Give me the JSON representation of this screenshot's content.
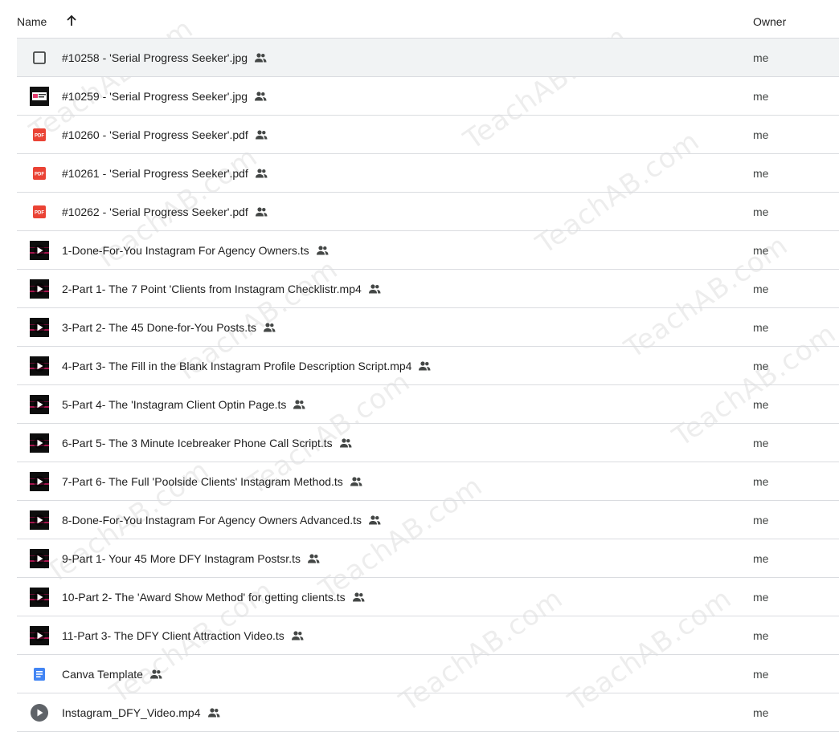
{
  "header": {
    "name_label": "Name",
    "owner_label": "Owner",
    "sort_icon": "arrow-up-icon"
  },
  "files": [
    {
      "name": "#10258 - 'Serial Progress Seeker'.jpg",
      "owner": "me",
      "icon": "image-icon",
      "shared": true
    },
    {
      "name": "#10259 - 'Serial Progress Seeker'.jpg",
      "owner": "me",
      "icon": "image-thumbnail-icon",
      "shared": true
    },
    {
      "name": "#10260 - 'Serial Progress Seeker'.pdf",
      "owner": "me",
      "icon": "pdf-icon",
      "shared": true
    },
    {
      "name": "#10261 - 'Serial Progress Seeker'.pdf",
      "owner": "me",
      "icon": "pdf-icon",
      "shared": true
    },
    {
      "name": "#10262 - 'Serial Progress Seeker'.pdf",
      "owner": "me",
      "icon": "pdf-icon",
      "shared": true
    },
    {
      "name": "1-Done-For-You Instagram For Agency Owners.ts",
      "owner": "me",
      "icon": "video-thumbnail-icon",
      "shared": true
    },
    {
      "name": "2-Part 1- The 7 Point 'Clients from Instagram Checklistr.mp4",
      "owner": "me",
      "icon": "video-thumbnail-icon",
      "shared": true
    },
    {
      "name": "3-Part 2- The 45 Done-for-You Posts.ts",
      "owner": "me",
      "icon": "video-thumbnail-icon",
      "shared": true
    },
    {
      "name": "4-Part 3- The Fill in the Blank Instagram Profile Description Script.mp4",
      "owner": "me",
      "icon": "video-thumbnail-icon",
      "shared": true
    },
    {
      "name": "5-Part 4- The 'Instagram Client Optin Page.ts",
      "owner": "me",
      "icon": "video-thumbnail-icon",
      "shared": true
    },
    {
      "name": "6-Part 5- The 3 Minute Icebreaker Phone Call Script.ts",
      "owner": "me",
      "icon": "video-thumbnail-icon",
      "shared": true
    },
    {
      "name": "7-Part 6- The Full 'Poolside Clients' Instagram Method.ts",
      "owner": "me",
      "icon": "video-thumbnail-icon",
      "shared": true
    },
    {
      "name": "8-Done-For-You Instagram For Agency Owners Advanced.ts",
      "owner": "me",
      "icon": "video-thumbnail-icon",
      "shared": true
    },
    {
      "name": "9-Part 1- Your 45 More DFY Instagram Postsr.ts",
      "owner": "me",
      "icon": "video-thumbnail-icon",
      "shared": true
    },
    {
      "name": "10-Part 2- The 'Award Show Method' for getting clients.ts",
      "owner": "me",
      "icon": "video-thumbnail-icon",
      "shared": true
    },
    {
      "name": "11-Part 3- The DFY Client Attraction Video.ts",
      "owner": "me",
      "icon": "video-thumbnail-icon",
      "shared": true
    },
    {
      "name": "Canva Template",
      "owner": "me",
      "icon": "google-docs-icon",
      "shared": true
    },
    {
      "name": "Instagram_DFY_Video.mp4",
      "owner": "me",
      "icon": "video-file-icon",
      "shared": true
    }
  ],
  "colors": {
    "pdf_red": "#ea4335",
    "docs_blue": "#4285f4",
    "selected_row_bg": "#f1f3f4",
    "divider": "#dadce0"
  },
  "watermark": "TeachAB.com"
}
